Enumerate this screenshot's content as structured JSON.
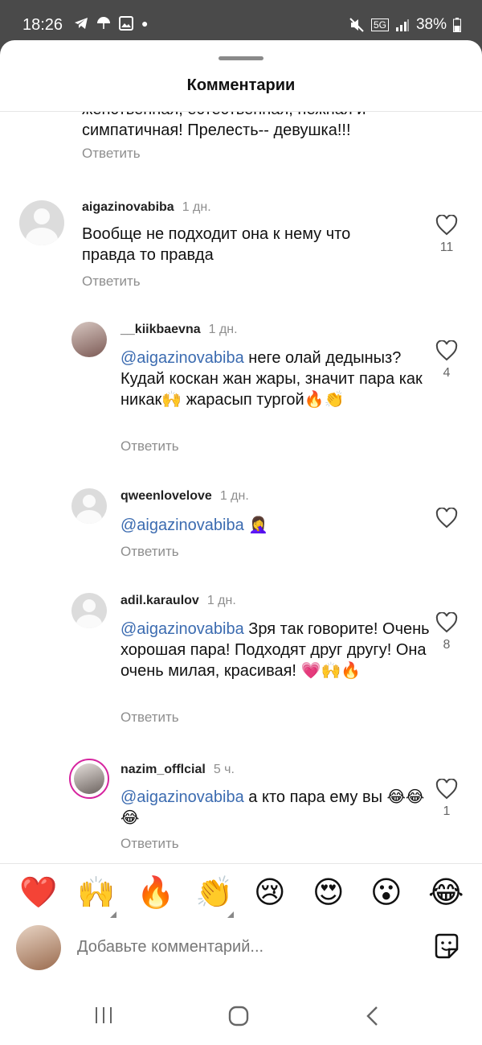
{
  "status": {
    "time": "18:26",
    "battery": "38%",
    "network": "5G"
  },
  "header": {
    "title": "Комментарии"
  },
  "comments": [
    {
      "text_line1": "женственная, естественная, нежная и",
      "text_line2": "симпатичная! Прелесть-- девушка!!!",
      "reply": "Ответить"
    },
    {
      "user": "aigazinovabiba",
      "time": "1 дн.",
      "text": "Вообще не подходит она к нему что правда то правда",
      "reply": "Ответить",
      "likes": "11"
    },
    {
      "user": "__kiikbaevna",
      "time": "1 дн.",
      "mention": "@aigazinovabiba",
      "text": " неге олай дедыныз? Кудай коскан жан жары, значит пара как никак🙌 жарасып тургой🔥👏",
      "reply": "Ответить",
      "likes": "4"
    },
    {
      "user": "qweenlovelove",
      "time": "1 дн.",
      "mention": "@aigazinovabiba",
      "text": " 🤦‍♀️",
      "reply": "Ответить"
    },
    {
      "user": "adil.karaulov",
      "time": "1 дн.",
      "mention": "@aigazinovabiba",
      "text": " Зря так говорите! Очень хорошая пара! Подходят друг другу!  Она очень милая, красивая! 💗🙌🔥",
      "reply": "Ответить",
      "likes": "8"
    },
    {
      "user": "nazim_offlcial",
      "time": "5 ч.",
      "mention": "@aigazinovabiba",
      "text": " а кто пара  ему вы 😂😂😂",
      "reply": "Ответить",
      "likes": "1"
    }
  ],
  "emojis": [
    "❤️",
    "🙌",
    "🔥",
    "👏",
    "😢",
    "😍",
    "😮",
    "😂"
  ],
  "compose": {
    "placeholder": "Добавьте комментарий..."
  },
  "icons": {
    "like": "heart-outline-icon",
    "sticker": "sticker-icon"
  }
}
